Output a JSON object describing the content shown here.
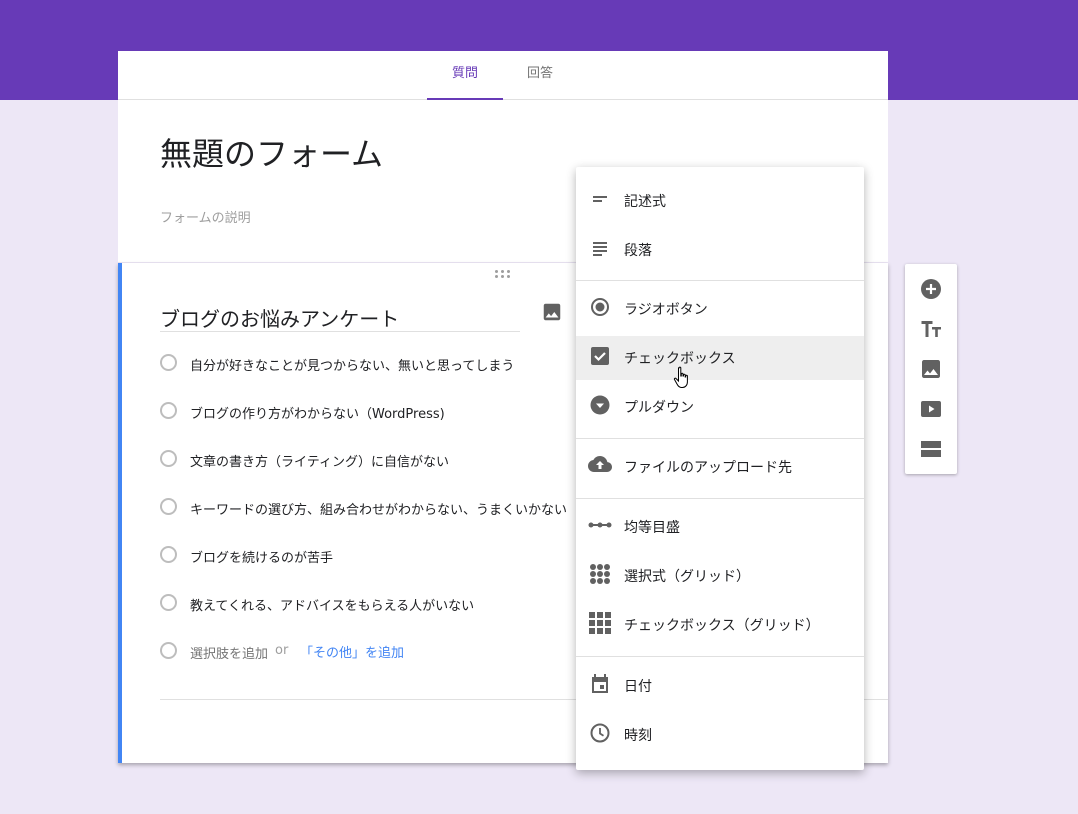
{
  "tabs": {
    "questions": "質問",
    "responses": "回答"
  },
  "form": {
    "title": "無題のフォーム",
    "description_placeholder": "フォームの説明"
  },
  "question": {
    "title": "ブログのお悩みアンケート",
    "options": [
      "自分が好きなことが見つからない、無いと思ってしまう",
      "ブログの作り方がわからない（WordPress)",
      "文章の書き方（ライティング）に自信がない",
      "キーワードの選び方、組み合わせがわからない、うまくいかない",
      "ブログを続けるのが苦手",
      "教えてくれる、アドバイスをもらえる人がいない"
    ],
    "add_option": "選択肢を追加",
    "or": "or",
    "add_other": "「その他」を追加"
  },
  "menu": {
    "short_answer": "記述式",
    "paragraph": "段落",
    "multiple_choice": "ラジオボタン",
    "checkboxes": "チェックボックス",
    "dropdown": "プルダウン",
    "file_upload": "ファイルのアップロード先",
    "linear_scale": "均等目盛",
    "mc_grid": "選択式（グリッド）",
    "checkbox_grid": "チェックボックス（グリッド）",
    "date": "日付",
    "time": "時刻",
    "highlighted_item": "チェックボックス"
  },
  "colors": {
    "theme": "#673ab7",
    "background": "#ede7f6",
    "accent": "#4285f4",
    "icon": "#616161"
  },
  "toolbar_icons": [
    "add-question-icon",
    "add-title-icon",
    "add-image-icon",
    "add-video-icon",
    "add-section-icon"
  ]
}
